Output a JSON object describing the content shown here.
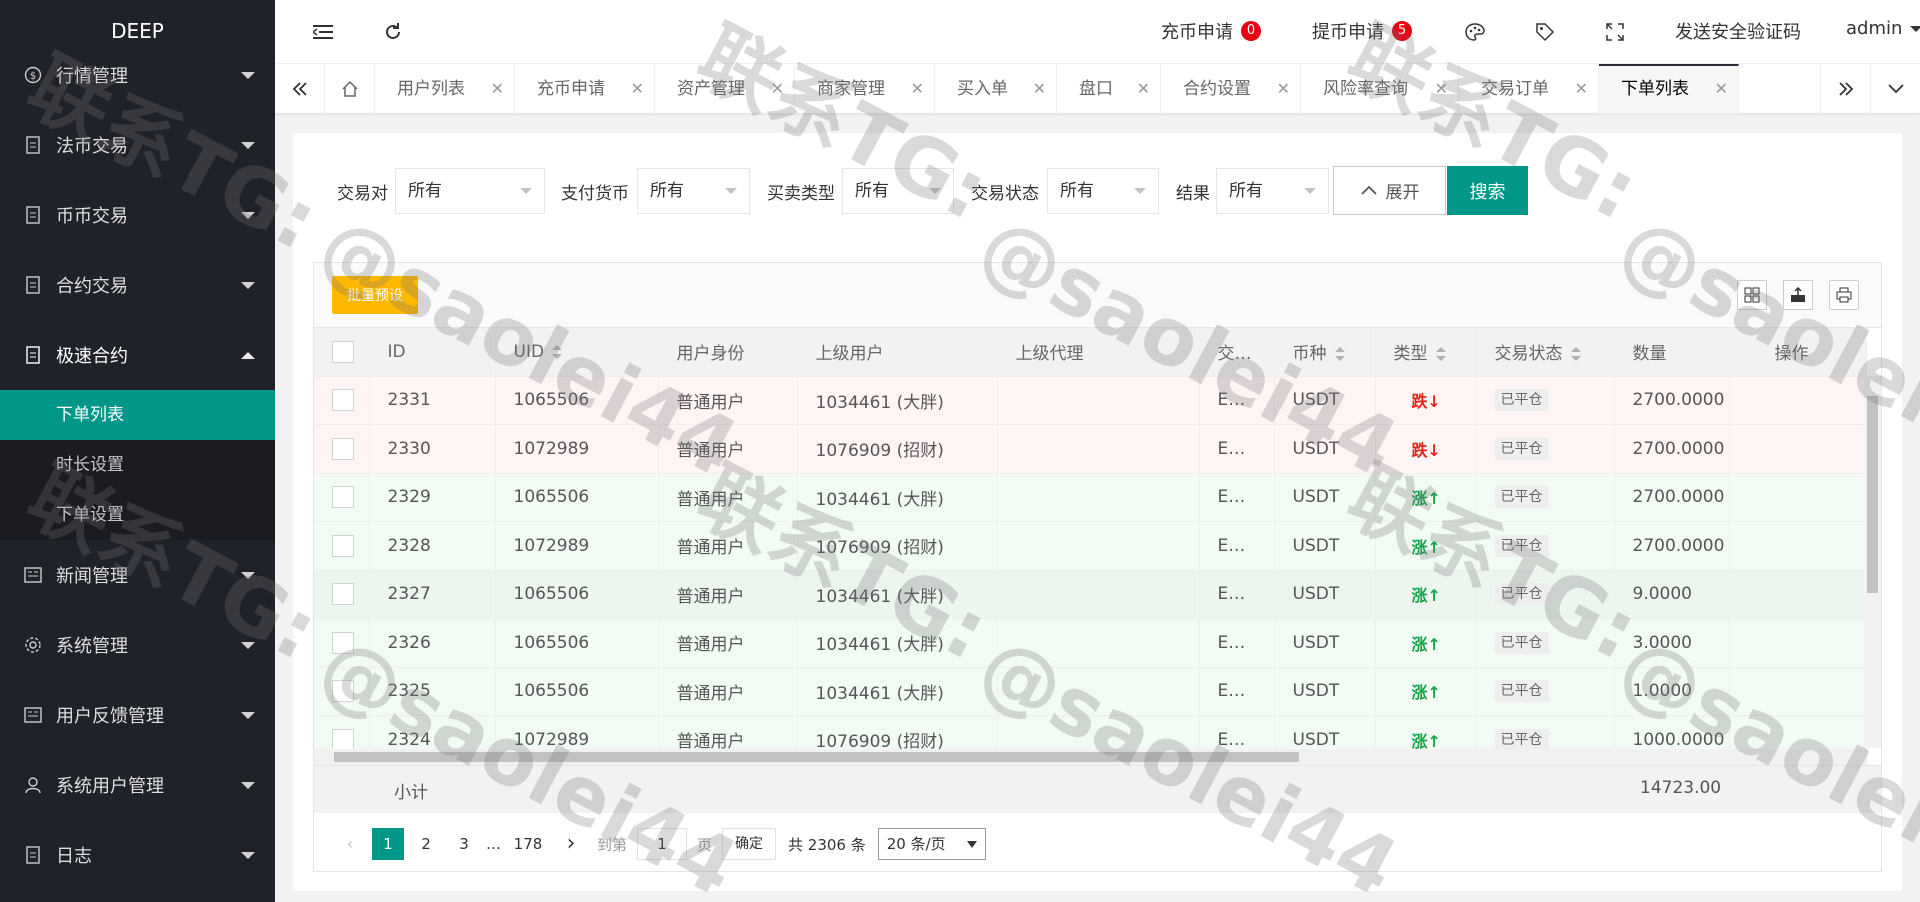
{
  "app": {
    "title": "DEEP"
  },
  "sidebar": {
    "items": [
      {
        "label": "行情管理",
        "icon": "dollar-circle-icon"
      },
      {
        "label": "法币交易",
        "icon": "document-icon"
      },
      {
        "label": "币币交易",
        "icon": "document-icon"
      },
      {
        "label": "合约交易",
        "icon": "document-icon"
      },
      {
        "label": "极速合约",
        "icon": "document-icon"
      },
      {
        "label": "新闻管理",
        "icon": "news-icon"
      },
      {
        "label": "系统管理",
        "icon": "gear-icon"
      },
      {
        "label": "用户反馈管理",
        "icon": "news-icon"
      },
      {
        "label": "系统用户管理",
        "icon": "user-icon"
      },
      {
        "label": "日志",
        "icon": "document-icon"
      }
    ],
    "subitems": [
      {
        "label": "下单列表",
        "active": true
      },
      {
        "label": "时长设置",
        "active": false
      },
      {
        "label": "下单设置",
        "active": false
      }
    ]
  },
  "header": {
    "recharge_label": "充币申请",
    "recharge_count": "0",
    "withdraw_label": "提币申请",
    "withdraw_count": "5",
    "send_code_label": "发送安全验证码",
    "user": "admin"
  },
  "tabs": [
    {
      "label": "用户列表"
    },
    {
      "label": "充币申请"
    },
    {
      "label": "资产管理"
    },
    {
      "label": "商家管理"
    },
    {
      "label": "买入单"
    },
    {
      "label": "盘口"
    },
    {
      "label": "合约设置"
    },
    {
      "label": "风险率查询"
    },
    {
      "label": "交易订单"
    },
    {
      "label": "下单列表"
    }
  ],
  "filters": {
    "pair_label": "交易对",
    "pair_value": "所有",
    "currency_label": "支付货币",
    "currency_value": "所有",
    "side_label": "买卖类型",
    "side_value": "所有",
    "status_label": "交易状态",
    "status_value": "所有",
    "result_label": "结果",
    "result_value": "所有",
    "expand_label": "展开",
    "search_label": "搜索"
  },
  "toolbar": {
    "batch_label": "批量预设"
  },
  "table": {
    "columns": [
      "ID",
      "UID",
      "用户身份",
      "上级用户",
      "上级代理",
      "交…",
      "币种",
      "类型",
      "交易状态",
      "数量",
      "操作"
    ],
    "rows": [
      {
        "id": "2331",
        "uid": "1065506",
        "role": "普通用户",
        "parent": "1034461 (大胖)",
        "agent": "",
        "pair": "E…",
        "coin": "USDT",
        "type": "跌↓",
        "dir": "down",
        "status": "已平仓",
        "qty": "2700.0000"
      },
      {
        "id": "2330",
        "uid": "1072989",
        "role": "普通用户",
        "parent": "1076909 (招财)",
        "agent": "",
        "pair": "E…",
        "coin": "USDT",
        "type": "跌↓",
        "dir": "down",
        "status": "已平仓",
        "qty": "2700.0000"
      },
      {
        "id": "2329",
        "uid": "1065506",
        "role": "普通用户",
        "parent": "1034461 (大胖)",
        "agent": "",
        "pair": "E…",
        "coin": "USDT",
        "type": "涨↑",
        "dir": "up",
        "status": "已平仓",
        "qty": "2700.0000"
      },
      {
        "id": "2328",
        "uid": "1072989",
        "role": "普通用户",
        "parent": "1076909 (招财)",
        "agent": "",
        "pair": "E…",
        "coin": "USDT",
        "type": "涨↑",
        "dir": "up",
        "status": "已平仓",
        "qty": "2700.0000"
      },
      {
        "id": "2327",
        "uid": "1065506",
        "role": "普通用户",
        "parent": "1034461 (大胖)",
        "agent": "",
        "pair": "E…",
        "coin": "USDT",
        "type": "涨↑",
        "dir": "up",
        "status": "已平仓",
        "qty": "9.0000"
      },
      {
        "id": "2326",
        "uid": "1065506",
        "role": "普通用户",
        "parent": "1034461 (大胖)",
        "agent": "",
        "pair": "E…",
        "coin": "USDT",
        "type": "涨↑",
        "dir": "up",
        "status": "已平仓",
        "qty": "3.0000"
      },
      {
        "id": "2325",
        "uid": "1065506",
        "role": "普通用户",
        "parent": "1034461 (大胖)",
        "agent": "",
        "pair": "E…",
        "coin": "USDT",
        "type": "涨↑",
        "dir": "up",
        "status": "已平仓",
        "qty": "1.0000"
      },
      {
        "id": "2324",
        "uid": "1072989",
        "role": "普通用户",
        "parent": "1076909 (招财)",
        "agent": "",
        "pair": "E…",
        "coin": "USDT",
        "type": "涨↑",
        "dir": "up",
        "status": "已平仓",
        "qty": "1000.0000"
      }
    ],
    "subtotal_label": "小计",
    "subtotal_qty": "14723.00"
  },
  "pager": {
    "pages": [
      "1",
      "2",
      "3",
      "…",
      "178"
    ],
    "goto_label": "到第",
    "goto_value": "1",
    "page_unit": "页",
    "confirm_label": "确定",
    "total_label": "共 2306 条",
    "per_page": "20 条/页"
  },
  "watermark": {
    "line1": "联系TG:",
    "line2": "@saolei44"
  },
  "colors": {
    "accent": "#009688",
    "sidebar": "#20222a",
    "batch": "#ffb800",
    "badge": "#e60012",
    "down": "#e2231a",
    "up": "#16a34a"
  }
}
